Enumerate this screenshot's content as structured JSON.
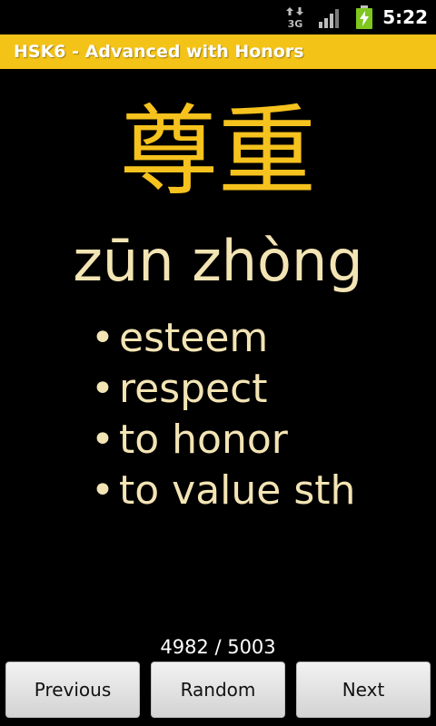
{
  "status_bar": {
    "time": "5:22",
    "network_type": "3G",
    "icons": [
      "data-transfer-icon",
      "signal-strength-icon",
      "battery-charging-icon"
    ],
    "battery_color": "#7fc61e"
  },
  "title_bar": {
    "title": "HSK6 - Advanced with Honors",
    "background_color": "#f4c318"
  },
  "card": {
    "hanzi": "尊重",
    "pinyin": "zūn zhòng",
    "bullet": "•",
    "definitions": [
      "esteem",
      "respect",
      "to honor",
      "to value sth"
    ],
    "hanzi_color": "#f6c21d",
    "text_color": "#f3e4b4"
  },
  "counter": {
    "text": "4982 / 5003",
    "current": 4982,
    "total": 5003
  },
  "buttons": {
    "previous": "Previous",
    "random": "Random",
    "next": "Next"
  }
}
